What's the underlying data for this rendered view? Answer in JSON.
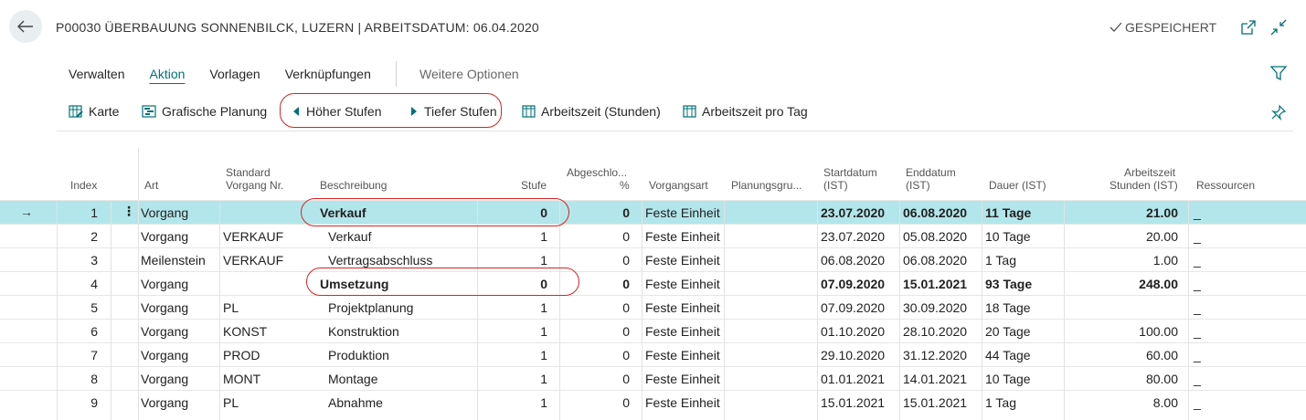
{
  "header": {
    "title": "P00030 ÜBERBAUUNG SONNENBILCK, LUZERN | ARBEITSDATUM: 06.04.2020",
    "status": "GESPEICHERT",
    "back_icon": "back-arrow-icon",
    "open_new_icon": "open-in-new-window-icon",
    "collapse_icon": "collapse-icon"
  },
  "menu": {
    "items": [
      "Verwalten",
      "Aktion",
      "Vorlagen",
      "Verknüpfungen"
    ],
    "active": "Aktion",
    "more": "Weitere Optionen"
  },
  "toolbar": {
    "karte": "Karte",
    "grafische": "Grafische Planung",
    "hoeher": "Höher Stufen",
    "tiefer": "Tiefer Stufen",
    "arbeitszeit_stunden": "Arbeitszeit (Stunden)",
    "arbeitszeit_tag": "Arbeitszeit pro Tag"
  },
  "columns": {
    "index": "Index",
    "art": "Art",
    "standard_1": "Standard",
    "standard_2": "Vorgang Nr.",
    "beschreibung": "Beschreibung",
    "stufe": "Stufe",
    "abgeschlossen_1": "Abgeschlo...",
    "abgeschlossen_2": "%",
    "vorgangsart": "Vorgangsart",
    "planungsgruppe": "Planungsgru...",
    "start_1": "Startdatum",
    "start_2": "(IST)",
    "end_1": "Enddatum",
    "end_2": "(IST)",
    "dauer": "Dauer (IST)",
    "arbeitszeit_1": "Arbeitszeit",
    "arbeitszeit_2": "Stunden (IST)",
    "ressourcen": "Ressourcen"
  },
  "rows": [
    {
      "index": "1",
      "art": "Vorgang",
      "nr": "",
      "beschreibung": "Verkauf",
      "stufe": "0",
      "pct": "0",
      "vorgangsart": "Feste Einheit",
      "planung": "",
      "start": "23.07.2020",
      "end": "06.08.2020",
      "dauer": "11 Tage",
      "stunden": "21.00",
      "ressourcen": "_"
    },
    {
      "index": "2",
      "art": "Vorgang",
      "nr": "VERKAUF",
      "beschreibung": "Verkauf",
      "stufe": "1",
      "pct": "0",
      "vorgangsart": "Feste Einheit",
      "planung": "",
      "start": "23.07.2020",
      "end": "05.08.2020",
      "dauer": "10 Tage",
      "stunden": "20.00",
      "ressourcen": "_"
    },
    {
      "index": "3",
      "art": "Meilenstein",
      "nr": "VERKAUF",
      "beschreibung": "Vertragsabschluss",
      "stufe": "1",
      "pct": "0",
      "vorgangsart": "Feste Einheit",
      "planung": "",
      "start": "06.08.2020",
      "end": "06.08.2020",
      "dauer": "1 Tag",
      "stunden": "1.00",
      "ressourcen": "_"
    },
    {
      "index": "4",
      "art": "Vorgang",
      "nr": "",
      "beschreibung": "Umsetzung",
      "stufe": "0",
      "pct": "0",
      "vorgangsart": "Feste Einheit",
      "planung": "",
      "start": "07.09.2020",
      "end": "15.01.2021",
      "dauer": "93 Tage",
      "stunden": "248.00",
      "ressourcen": "_"
    },
    {
      "index": "5",
      "art": "Vorgang",
      "nr": "PL",
      "beschreibung": "Projektplanung",
      "stufe": "1",
      "pct": "0",
      "vorgangsart": "Feste Einheit",
      "planung": "",
      "start": "07.09.2020",
      "end": "30.09.2020",
      "dauer": "18 Tage",
      "stunden": "",
      "ressourcen": "_"
    },
    {
      "index": "6",
      "art": "Vorgang",
      "nr": "KONST",
      "beschreibung": "Konstruktion",
      "stufe": "1",
      "pct": "0",
      "vorgangsart": "Feste Einheit",
      "planung": "",
      "start": "01.10.2020",
      "end": "28.10.2020",
      "dauer": "20 Tage",
      "stunden": "100.00",
      "ressourcen": "_"
    },
    {
      "index": "7",
      "art": "Vorgang",
      "nr": "PROD",
      "beschreibung": "Produktion",
      "stufe": "1",
      "pct": "0",
      "vorgangsart": "Feste Einheit",
      "planung": "",
      "start": "29.10.2020",
      "end": "31.12.2020",
      "dauer": "44 Tage",
      "stunden": "60.00",
      "ressourcen": "_"
    },
    {
      "index": "8",
      "art": "Vorgang",
      "nr": "MONT",
      "beschreibung": "Montage",
      "stufe": "1",
      "pct": "0",
      "vorgangsart": "Feste Einheit",
      "planung": "",
      "start": "01.01.2021",
      "end": "14.01.2021",
      "dauer": "10 Tage",
      "stunden": "80.00",
      "ressourcen": "_"
    },
    {
      "index": "9",
      "art": "Vorgang",
      "nr": "PL",
      "beschreibung": "Abnahme",
      "stufe": "1",
      "pct": "0",
      "vorgangsart": "Feste Einheit",
      "planung": "",
      "start": "15.01.2021",
      "end": "15.01.2021",
      "dauer": "1 Tag",
      "stunden": "8.00",
      "ressourcen": "_"
    }
  ]
}
